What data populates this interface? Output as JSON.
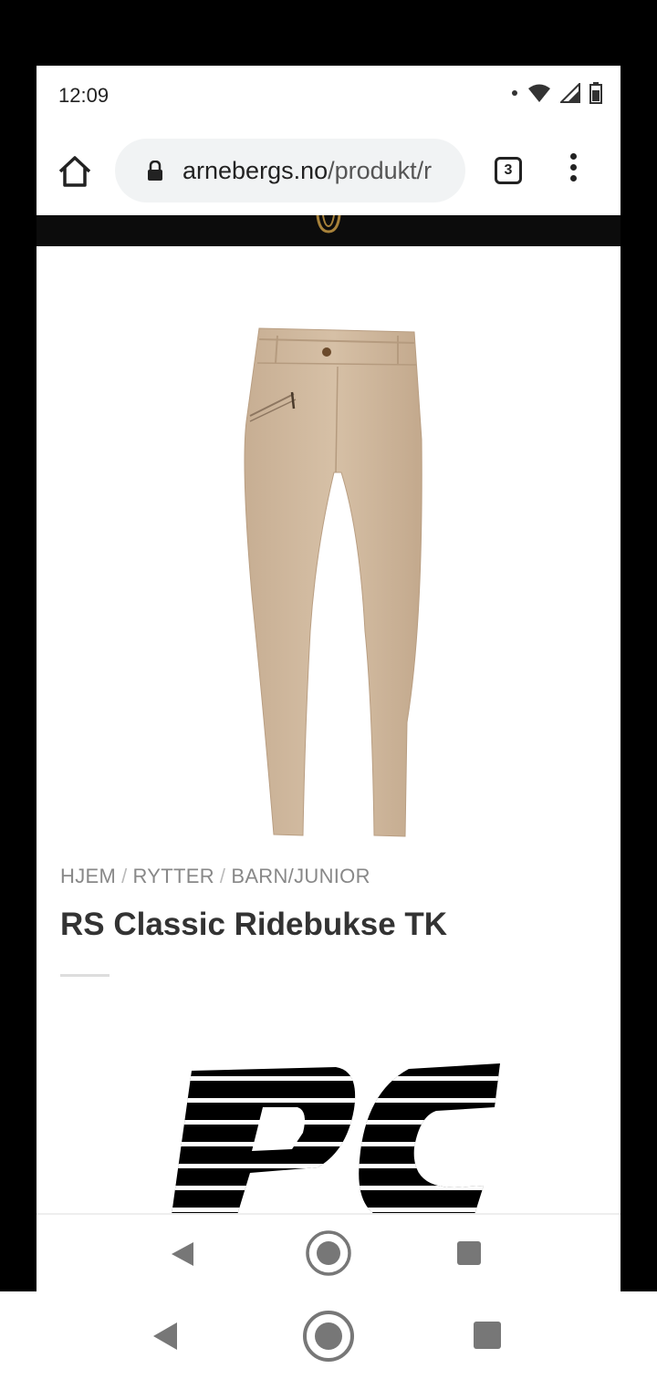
{
  "status": {
    "time": "12:09"
  },
  "browser": {
    "url_domain": "arnebergs.no",
    "url_path": "/produkt/r",
    "tab_count": "3"
  },
  "product": {
    "breadcrumb": [
      "HJEM",
      "RYTTER",
      "BARN/JUNIOR"
    ],
    "breadcrumb_sep": "/",
    "title": "RS Classic Ridebukse TK"
  },
  "colors": {
    "pants": "#d3bca2",
    "header": "#0c0c0c",
    "breadcrumb": "#888888",
    "title": "#333333"
  },
  "icons": {
    "home": "home-icon",
    "lock": "lock-icon",
    "menu": "more-vert-icon",
    "back": "back-triangle-icon",
    "home_nav": "home-circle-icon",
    "recents": "recents-square-icon"
  }
}
